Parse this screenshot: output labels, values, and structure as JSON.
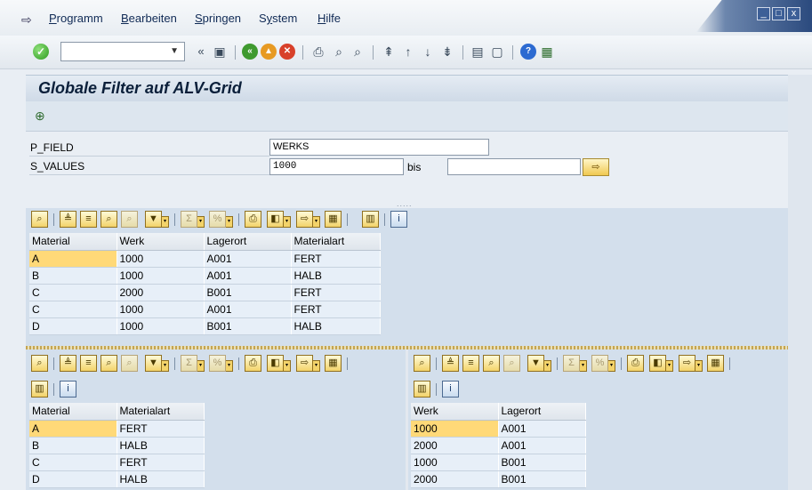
{
  "window": {
    "menu": [
      "Programm",
      "Bearbeiten",
      "Springen",
      "System",
      "Hilfe"
    ],
    "menu_mnemonic": [
      "P",
      "B",
      "S",
      "y",
      "H"
    ],
    "controls": {
      "minimize": "_",
      "maximize": "□",
      "close": "x"
    }
  },
  "toolbar": {
    "command_field_value": "",
    "icons": [
      "ok-check",
      "command-field",
      "back-double-arrow",
      "save",
      "back",
      "exit",
      "cancel",
      "print",
      "find",
      "find-next",
      "first-page",
      "previous-page",
      "next-page",
      "last-page",
      "create-session",
      "shortcut",
      "help",
      "customize-layout"
    ]
  },
  "title": "Globale Filter auf ALV-Grid",
  "selection": {
    "p_field": {
      "label": "P_FIELD",
      "value": "WERKS"
    },
    "s_values": {
      "label": "S_VALUES",
      "low": "1000",
      "bis": "bis",
      "high": ""
    }
  },
  "splitter_mark": ".....",
  "grid_top": {
    "columns": [
      "Material",
      "Werk",
      "Lagerort",
      "Materialart"
    ],
    "rows": [
      [
        "A",
        "1000",
        "A001",
        "FERT"
      ],
      [
        "B",
        "1000",
        "A001",
        "HALB"
      ],
      [
        "C",
        "2000",
        "B001",
        "FERT"
      ],
      [
        "C",
        "1000",
        "A001",
        "FERT"
      ],
      [
        "D",
        "1000",
        "B001",
        "HALB"
      ]
    ]
  },
  "grid_bottom_left": {
    "columns": [
      "Material",
      "Materialart"
    ],
    "rows": [
      [
        "A",
        "FERT"
      ],
      [
        "B",
        "HALB"
      ],
      [
        "C",
        "FERT"
      ],
      [
        "D",
        "HALB"
      ]
    ]
  },
  "grid_bottom_right": {
    "columns": [
      "Werk",
      "Lagerort"
    ],
    "rows": [
      [
        "1000",
        "A001"
      ],
      [
        "2000",
        "A001"
      ],
      [
        "1000",
        "B001"
      ],
      [
        "2000",
        "B001"
      ]
    ]
  },
  "alv_toolbar_icons": [
    "details",
    "sort-ascending",
    "sort-descending",
    "find",
    "find-next",
    "filter",
    "total",
    "subtotal",
    "print",
    "views",
    "export",
    "layout",
    "graphic",
    "info"
  ],
  "colors": {
    "selected_cell": "#ffd978",
    "grid_background": "#d3dfec",
    "title_text": "#0b1f3a"
  }
}
